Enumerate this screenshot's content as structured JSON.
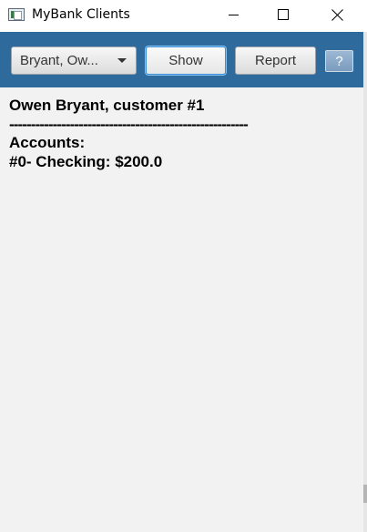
{
  "window": {
    "title": "MyBank Clients"
  },
  "toolbar": {
    "client_select_value": "Bryant, Ow...",
    "show_label": "Show",
    "report_label": "Report",
    "help_label": "?"
  },
  "content": {
    "customer_line": "Owen Bryant, customer #1",
    "separator": "-------------------------------------------------------",
    "accounts_heading": "Accounts:",
    "accounts": [
      {
        "text": "#0- Checking: $200.0"
      }
    ]
  },
  "colors": {
    "toolbar_bg": "#2e6a9c",
    "content_bg": "#f2f2f2"
  }
}
